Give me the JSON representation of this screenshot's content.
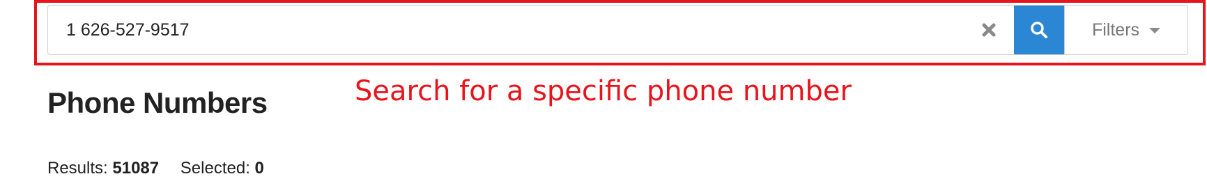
{
  "search": {
    "value": "1 626-527-9517",
    "filters_label": "Filters"
  },
  "annotation": {
    "text": "Search for a specific phone number",
    "color": "#e8141b"
  },
  "page": {
    "title": "Phone Numbers"
  },
  "stats": {
    "results_label": "Results:",
    "results_value": "51087",
    "selected_label": "Selected:",
    "selected_value": "0"
  },
  "colors": {
    "accent": "#2b86d3",
    "highlight": "#e8141b"
  },
  "icons": {
    "clear": "close-icon",
    "search": "search-icon",
    "dropdown": "caret-down-icon"
  }
}
